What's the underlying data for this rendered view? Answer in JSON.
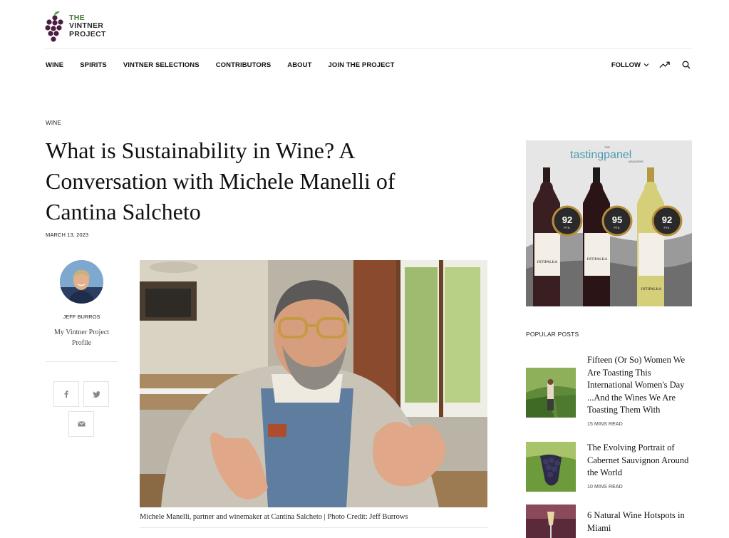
{
  "brand": {
    "line1": "THE",
    "line2": "VINTNER",
    "line3": "PROJECT"
  },
  "nav": {
    "items": [
      "WINE",
      "SPIRITS",
      "VINTNER SELECTIONS",
      "CONTRIBUTORS",
      "ABOUT",
      "JOIN THE PROJECT"
    ],
    "follow_label": "FOLLOW"
  },
  "article": {
    "category": "WINE",
    "title": "What is Sustainability in Wine? A Conversation with Michele Manelli of Cantina Salcheto",
    "date": "MARCH 13, 2023",
    "author_name": "JEFF BURROS",
    "author_link": "My Vintner Project Profile",
    "caption": "Michele Manelli, partner and winemaker at Cantina Salcheto | Photo Credit: Jeff Burrows"
  },
  "ad": {
    "brand_pre": "THE",
    "brand_main": "tastingpanel",
    "brand_sub": "MAGAZINE",
    "scores": [
      "92",
      "95",
      "92"
    ],
    "score_unit": "PTS.",
    "bottle_labels": [
      "INTIPALKA",
      "INTIPALKA",
      "INTIPALKA"
    ]
  },
  "sidebar": {
    "popular_heading": "POPULAR POSTS",
    "posts": [
      {
        "title": "Fifteen (Or So) Women We Are Toasting This International Women's Day ...And the Wines We Are Toasting Them With",
        "meta": "15 MINS READ"
      },
      {
        "title": "The Evolving Portrait of Cabernet Sauvignon Around the World",
        "meta": "10 MINS READ"
      },
      {
        "title": "6 Natural Wine Hotspots in Miami",
        "meta": ""
      }
    ]
  },
  "colors": {
    "brand_green": "#4a7a3a",
    "grape_purple": "#4b1f3f",
    "text": "#111111"
  },
  "icons": [
    "grapes-logo-icon",
    "chevron-down-icon",
    "trending-icon",
    "search-icon",
    "facebook-icon",
    "twitter-icon",
    "mail-icon"
  ]
}
